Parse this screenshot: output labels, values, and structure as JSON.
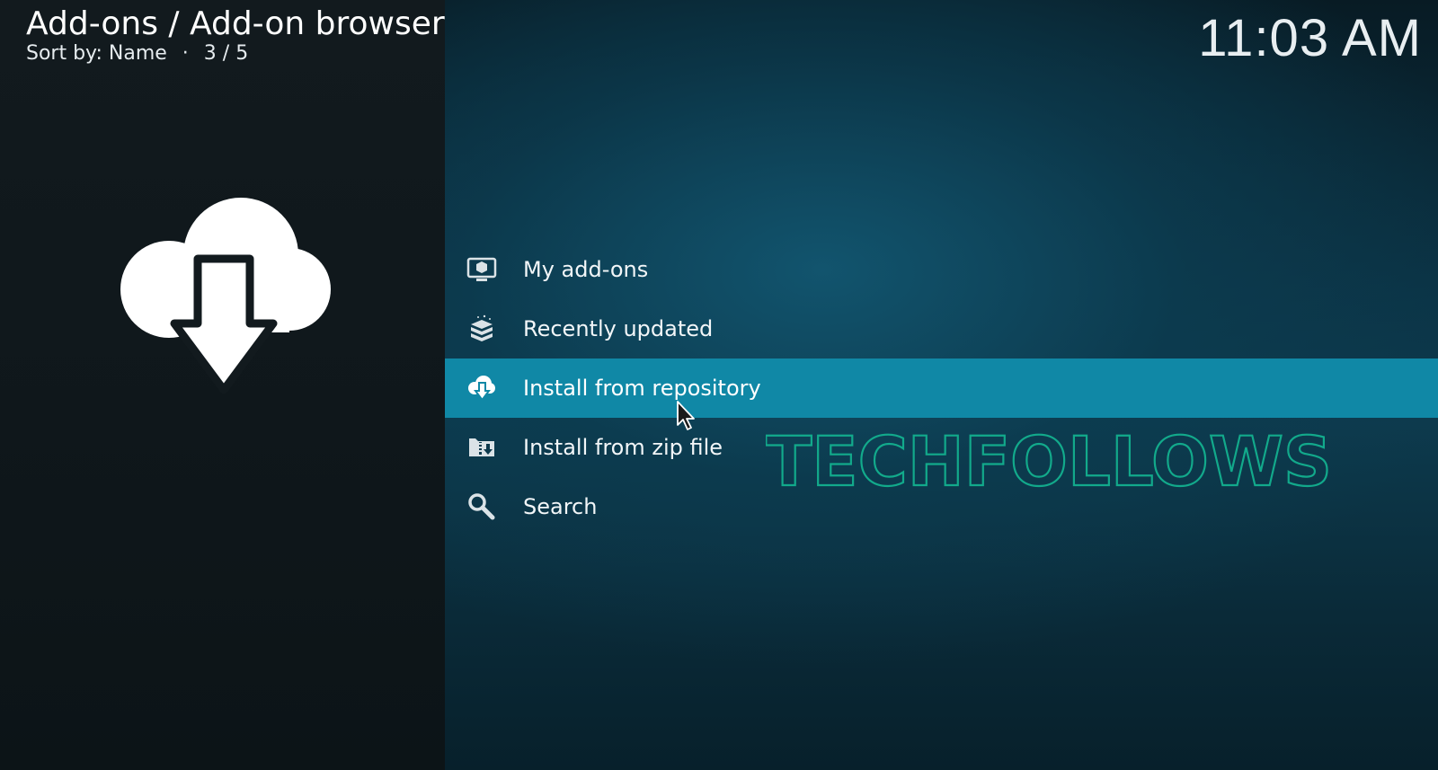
{
  "header": {
    "breadcrumb": "Add-ons / Add-on browser",
    "sort_label": "Sort by: Name",
    "separator": "·",
    "position": "3 / 5",
    "clock": "11:03 AM"
  },
  "hero": {
    "icon": "cloud-download-icon"
  },
  "menu": {
    "selected_index": 2,
    "items": [
      {
        "label": "My add-ons",
        "icon": "monitor-box-icon"
      },
      {
        "label": "Recently updated",
        "icon": "boxes-icon"
      },
      {
        "label": "Install from repository",
        "icon": "cloud-download-icon"
      },
      {
        "label": "Install from zip file",
        "icon": "zip-install-icon"
      },
      {
        "label": "Search",
        "icon": "search-icon"
      }
    ]
  },
  "watermark": {
    "text": "TECHFOLLOWS",
    "color": "#13b08f"
  },
  "colors": {
    "accent": "#1088a6",
    "left_panel": "#121a1e",
    "main_panel": "#0d3a4d"
  }
}
